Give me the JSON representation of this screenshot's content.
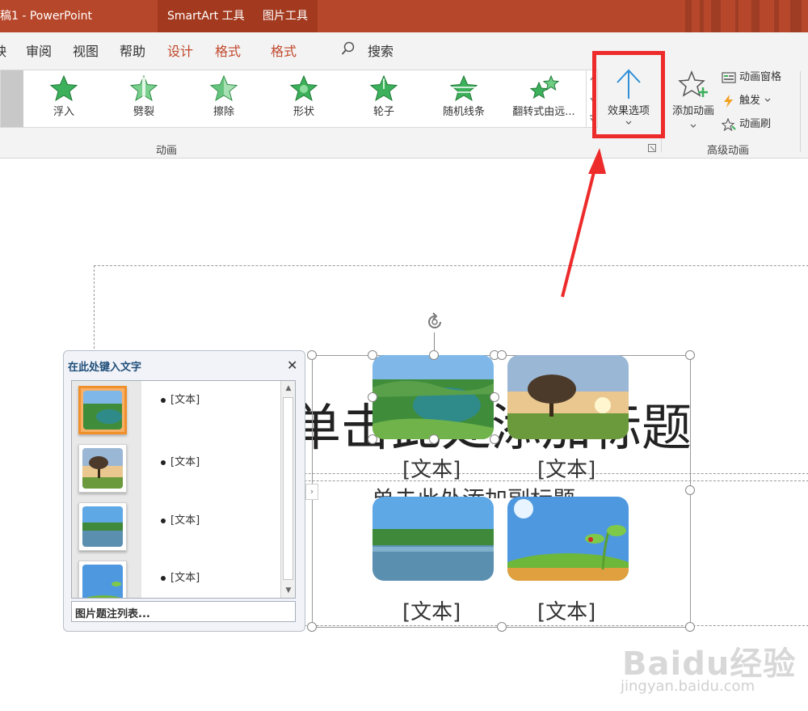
{
  "titlebar": {
    "doc_title": "稿1 - PowerPoint",
    "context_tabs": [
      "SmartArt 工具",
      "图片工具"
    ]
  },
  "tabs": {
    "items": [
      "映",
      "审阅",
      "视图",
      "帮助",
      "设计",
      "格式",
      "格式"
    ],
    "search_label": "搜索"
  },
  "ribbon": {
    "animations": [
      "浮入",
      "劈裂",
      "擦除",
      "形状",
      "轮子",
      "随机线条",
      "翻转式由远..."
    ],
    "animation_group_label": "动画",
    "effect_options_label": "效果选项",
    "add_animation_label": "添加动画",
    "animation_pane_label": "动画窗格",
    "trigger_label": "触发",
    "animation_painter_label": "动画刷",
    "advanced_group_label": "高级动画"
  },
  "slide": {
    "title_placeholder": "单击此处添加标题",
    "subtitle_placeholder": "单击此处添加副标题",
    "captions": [
      "[文本]",
      "[文本]",
      "[文本]",
      "[文本]"
    ]
  },
  "text_pane": {
    "title": "在此处键入文字",
    "close_glyph": "✕",
    "items": [
      "[文本]",
      "[文本]",
      "[文本]",
      "[文本]"
    ],
    "caption_list_button": "图片题注列表..."
  },
  "watermark": {
    "brand": "Baidu经验",
    "url": "jingyan.baidu.com"
  },
  "colors": {
    "titlebar": "#b7472a",
    "context_tab": "#c0472b",
    "annotation_red": "#ee2b2b",
    "star_green": "#3cb05a"
  }
}
